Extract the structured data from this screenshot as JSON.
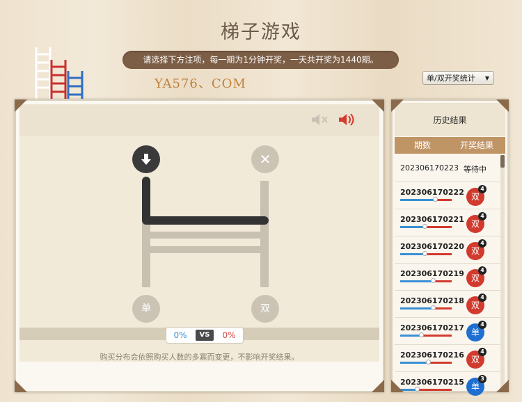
{
  "title": "梯子游戏",
  "notice": "请选择下方注项，每一期为1分钟开奖，一天共开奖为1440期。",
  "watermark": "YA576、COM",
  "stat_select": {
    "value": "单/双开奖统计"
  },
  "game": {
    "start_left_icon": "down-arrow-icon",
    "start_right_icon": "close-icon",
    "end_left_label": "单",
    "end_right_label": "双",
    "mute_icon": "mute-speaker-icon",
    "sound_icon": "speaker-icon",
    "vs": {
      "left": "0%",
      "mid": "VS",
      "right": "0%"
    },
    "disclaimer": "购买分布会依照购买人数的多寡而变更，不影响开奖结果。"
  },
  "history": {
    "title": "历史结果",
    "col_period": "期数",
    "col_result": "开奖结果",
    "pending": {
      "period": "202306170223",
      "status": "等待中"
    },
    "rows": [
      {
        "period": "202306170222",
        "result": "双",
        "num": "4",
        "color": "#d23a2e",
        "split": 0.68
      },
      {
        "period": "202306170221",
        "result": "双",
        "num": "4",
        "color": "#d23a2e",
        "split": 0.47
      },
      {
        "period": "202306170220",
        "result": "双",
        "num": "4",
        "color": "#d23a2e",
        "split": 0.47
      },
      {
        "period": "202306170219",
        "result": "双",
        "num": "4",
        "color": "#d23a2e",
        "split": 0.63
      },
      {
        "period": "202306170218",
        "result": "双",
        "num": "4",
        "color": "#d23a2e",
        "split": 0.63
      },
      {
        "period": "202306170217",
        "result": "单",
        "num": "4",
        "color": "#1f6fd1",
        "split": 0.4
      },
      {
        "period": "202306170216",
        "result": "双",
        "num": "4",
        "color": "#d23a2e",
        "split": 0.54
      },
      {
        "period": "202306170215",
        "result": "单",
        "num": "3",
        "color": "#1f6fd1",
        "split": 0.32
      }
    ]
  },
  "colors": {
    "accent": "#7c5d45",
    "odd": "#1f6fd1",
    "even": "#d23a2e"
  }
}
